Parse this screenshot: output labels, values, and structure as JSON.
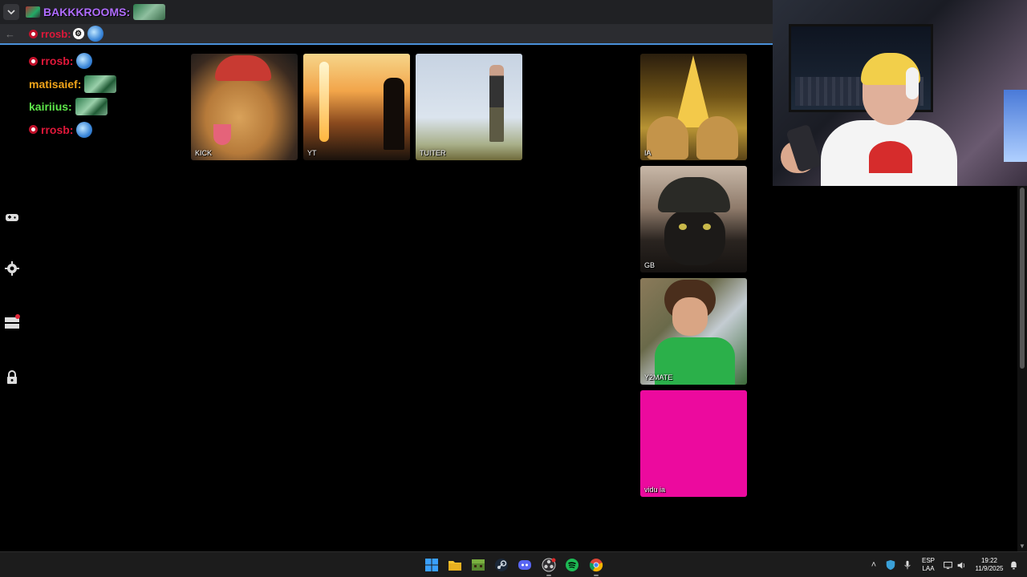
{
  "window": {
    "tab_title": "BAKKKROOMS:"
  },
  "address_bar": {
    "user_text": "rrosb:"
  },
  "chat": {
    "messages": [
      {
        "badge": true,
        "name": "rrosb:",
        "name_color": "#e0183a",
        "emote": "globe-emote"
      },
      {
        "badge": false,
        "name": "matisaief:",
        "name_color": "#f2a51a",
        "emote": "green-emote"
      },
      {
        "badge": false,
        "name": "kairiius:",
        "name_color": "#5ee84a",
        "emote": "green-emote"
      },
      {
        "badge": true,
        "name": "rrosb:",
        "name_color": "#e0183a",
        "emote": "globe-emote"
      }
    ]
  },
  "sidebar": {
    "icons": [
      "gamepad-icon",
      "gear-icon",
      "layers-notification-icon",
      "lock-icon"
    ],
    "notification_color": "#e0283a"
  },
  "tiles": [
    {
      "label": "KICK"
    },
    {
      "label": "YT"
    },
    {
      "label": "TUITER"
    },
    {
      "label": "IA"
    },
    {
      "label": "GB"
    },
    {
      "label": "Y2MATE"
    },
    {
      "label": "vidu ia",
      "color": "#ec0a9e"
    }
  ],
  "taskbar": {
    "apps": [
      "windows-start-icon",
      "file-explorer-icon",
      "minecraft-icon",
      "steam-icon",
      "discord-icon",
      "obs-icon",
      "spotify-icon",
      "chrome-icon"
    ],
    "tray": {
      "language_line1": "ESP",
      "language_line2": "LAA",
      "time": "19:22",
      "date": "11/9/2025"
    }
  }
}
